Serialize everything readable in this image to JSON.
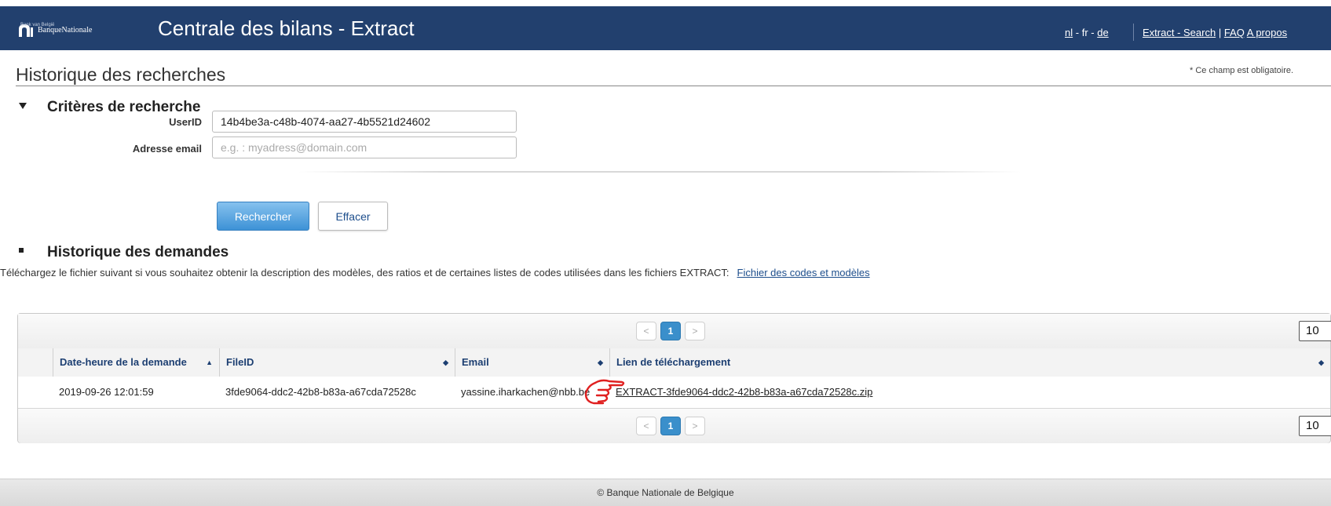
{
  "header": {
    "logo_text": "BanqueNationale",
    "logo_subtext": "Bank van België",
    "title": "Centrale des bilans - Extract",
    "languages": [
      "nl",
      "fr",
      "de"
    ],
    "links": [
      "Extract - Search",
      "FAQ",
      "A propos"
    ]
  },
  "page": {
    "title": "Historique des recherches",
    "required_note": "* Ce champ est obligatoire."
  },
  "criteria": {
    "heading": "Critères de recherche",
    "userid_label": "UserID",
    "userid_value": "14b4be3a-c48b-4074-aa27-4b5521d24602",
    "email_label": "Adresse email",
    "email_placeholder": "e.g. : myadress@domain.com",
    "search_button": "Rechercher",
    "clear_button": "Effacer"
  },
  "history": {
    "heading": "Historique des demandes",
    "description": "Téléchargez le fichier suivant si vous souhaitez obtenir la description des modèles, des ratios et de certaines listes de codes utilisées dans les fichiers EXTRACT:",
    "codes_link": "Fichier des codes et modèles",
    "pager": {
      "prev": "<",
      "current": "1",
      "next": ">",
      "page_size": "10"
    },
    "columns": [
      "Date-heure de la demande",
      "FileID",
      "Email",
      "Lien de téléchargement"
    ],
    "rows": [
      {
        "date": "2019-09-26 12:01:59",
        "file_id": "3fde9064-ddc2-42b8-b83a-a67cda72528c",
        "email": "yassine.iharkachen@nbb.be",
        "download": "EXTRACT-3fde9064-ddc2-42b8-b83a-a67cda72528c.zip"
      }
    ]
  },
  "footer": {
    "copyright": "© Banque Nationale de Belgique"
  },
  "colors": {
    "header_bg": "#22406e",
    "primary_button": "#3d92d6",
    "page_current": "#3a8fcb",
    "annotation": "#e02020"
  }
}
